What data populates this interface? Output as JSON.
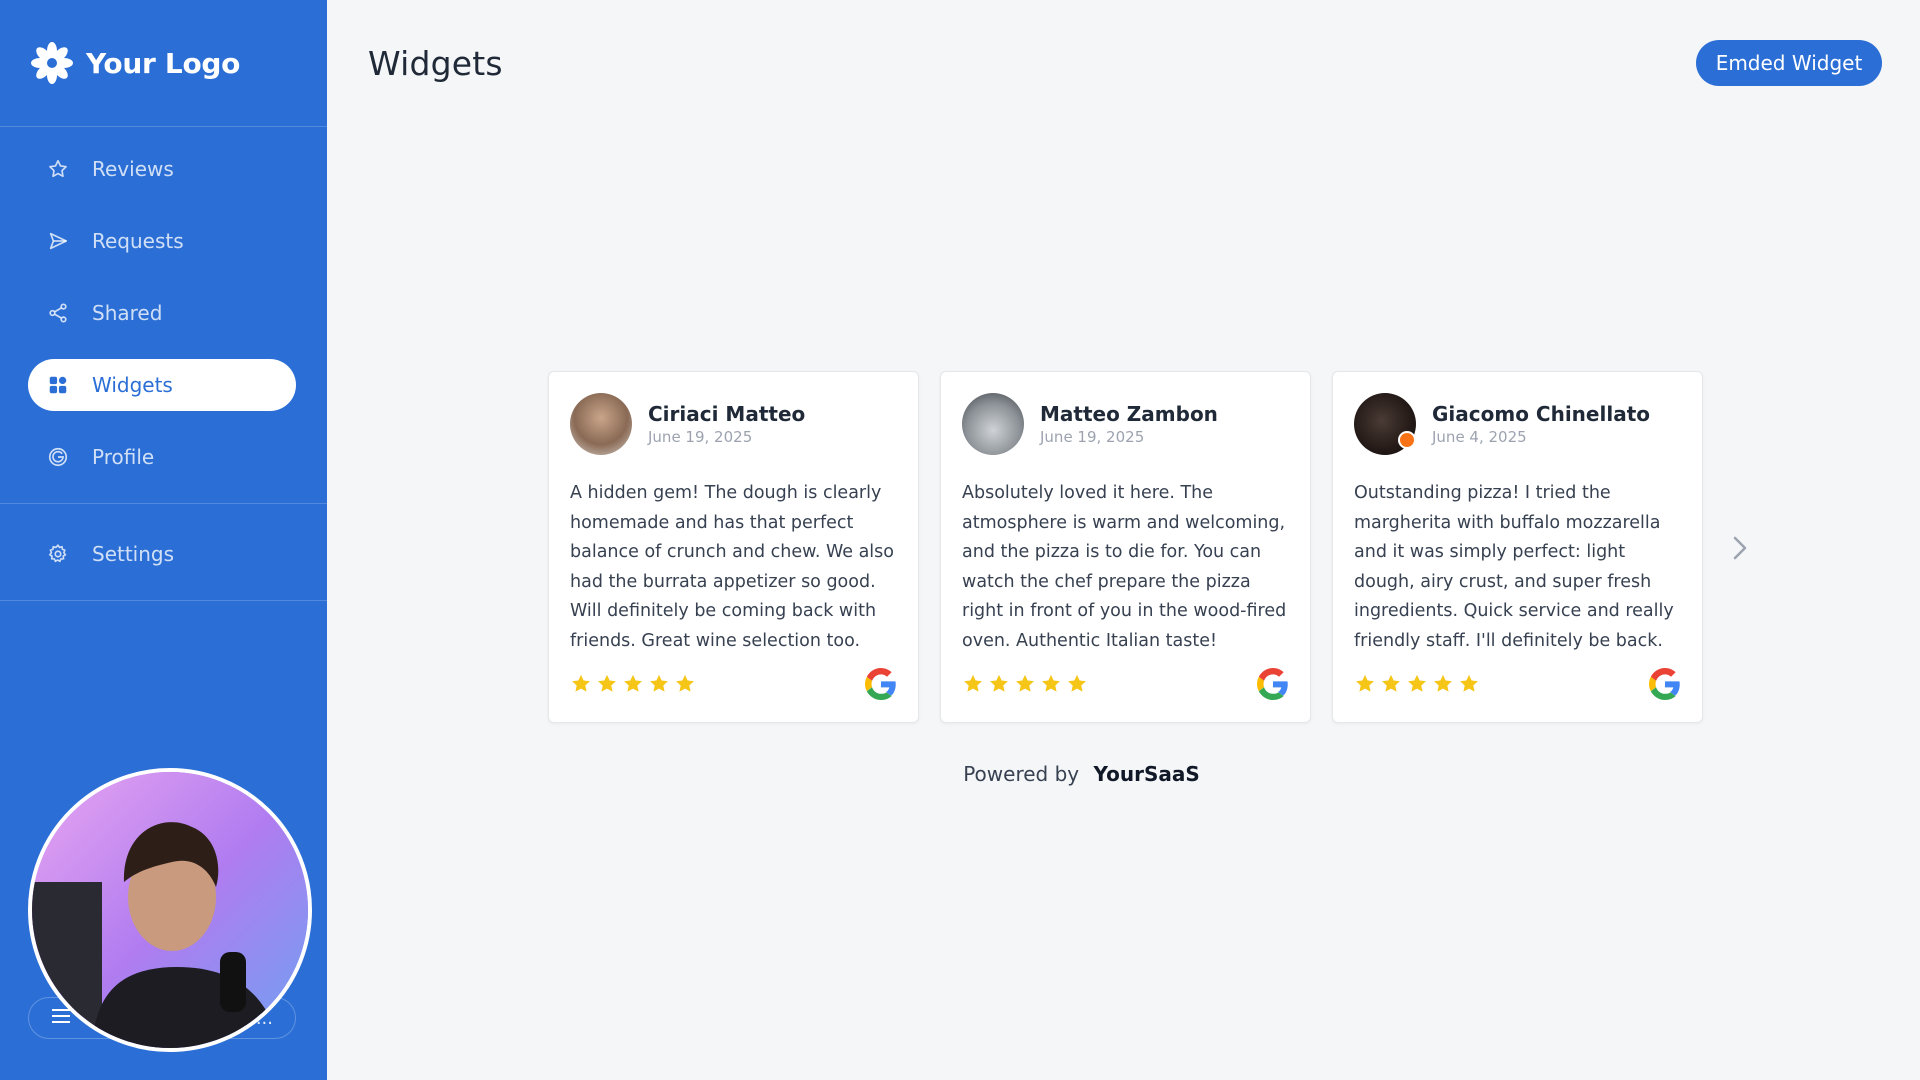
{
  "brand": {
    "logo_text": "Your Logo"
  },
  "sidebar": {
    "items": [
      {
        "label": "Reviews",
        "icon": "star-icon",
        "active": false
      },
      {
        "label": "Requests",
        "icon": "send-icon",
        "active": false
      },
      {
        "label": "Shared",
        "icon": "share-icon",
        "active": false
      },
      {
        "label": "Widgets",
        "icon": "grid-icon",
        "active": true
      },
      {
        "label": "Profile",
        "icon": "google-icon",
        "active": false
      },
      {
        "label": "Settings",
        "icon": "gear-icon",
        "active": false
      }
    ],
    "menu_pill": {
      "left_icon": "menu-icon",
      "right_text": "..."
    }
  },
  "header": {
    "title": "Widgets",
    "embed_button_label": "Emded Widget"
  },
  "reviews": [
    {
      "name": "Ciriaci Matteo",
      "date": "June 19, 2025",
      "text": "A hidden gem! The dough is clearly homemade and has that perfect balance of crunch and chew. We also had the burrata appetizer so good. Will definitely be coming back with friends. Great wine selection too.",
      "rating": 5,
      "source_icon": "google-icon"
    },
    {
      "name": "Matteo Zambon",
      "date": "June 19, 2025",
      "text": "Absolutely loved it here. The atmosphere is warm and welcoming, and the pizza is to die for. You can watch the chef prepare the pizza right in front of you in the wood-fired oven. Authentic Italian taste!",
      "rating": 5,
      "source_icon": "google-icon"
    },
    {
      "name": "Giacomo Chinellato",
      "date": "June 4, 2025",
      "text": "Outstanding pizza! I tried the margherita with buffalo mozzarella and it was simply perfect: light dough, airy crust, and super fresh ingredients. Quick service and really friendly staff. I'll definitely be back.",
      "rating": 5,
      "source_icon": "google-icon"
    }
  ],
  "footer": {
    "powered_prefix": "Powered by",
    "powered_brand": "YourSaaS"
  },
  "colors": {
    "primary": "#2b6fd6",
    "star": "#f5c518",
    "background": "#f5f6f8"
  }
}
